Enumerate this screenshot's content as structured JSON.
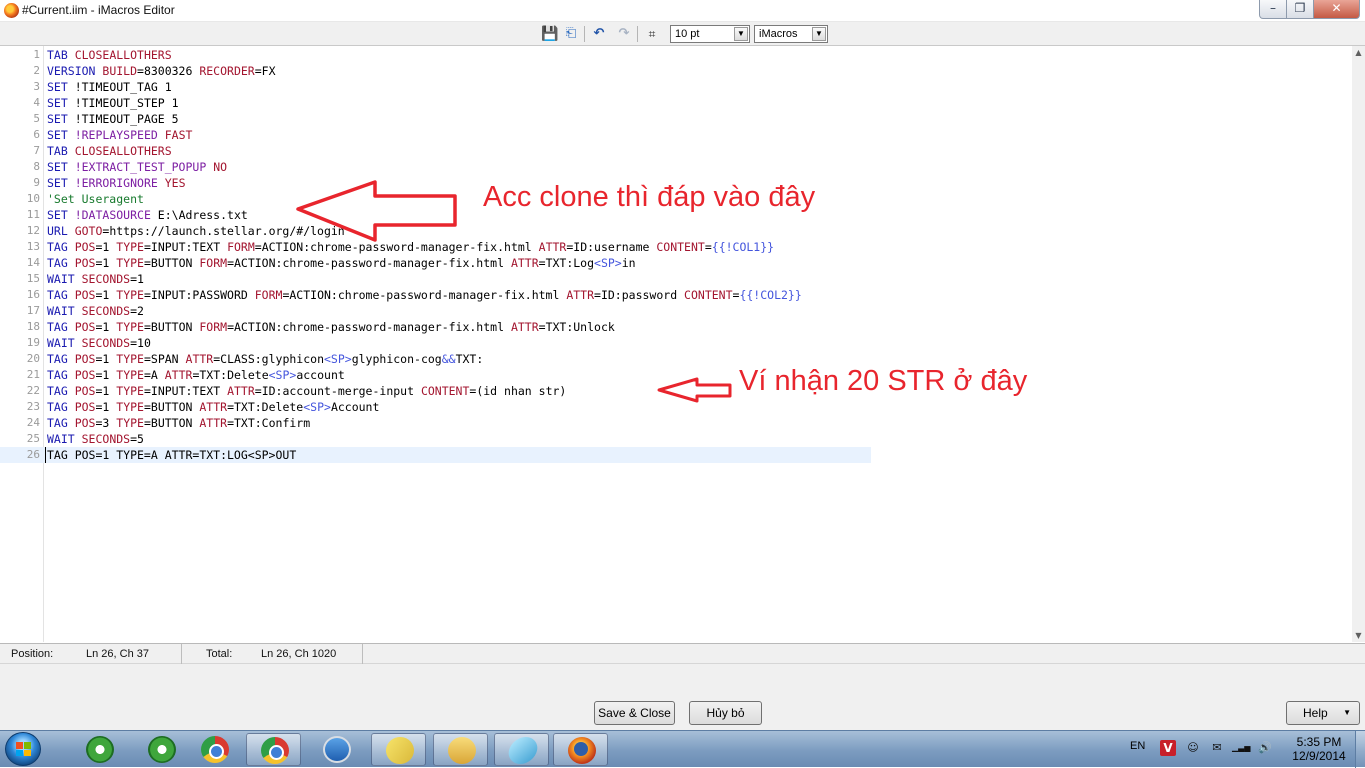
{
  "window": {
    "title": "#Current.iim - iMacros Editor",
    "minimize_glyph": "–",
    "maximize_glyph": "❐",
    "close_glyph": "✕"
  },
  "toolbar": {
    "font_size": "10 pt",
    "syntax_mode": "iMacros",
    "dropdown_glyph": "▼",
    "icons": {
      "save": "💾",
      "open": "⎗",
      "undo": "↶",
      "redo": "↷",
      "find": "⌗"
    }
  },
  "editor": {
    "lines": [
      {
        "n": "1",
        "segs": [
          [
            "cmd",
            "TAB"
          ],
          [
            "",
            ""
          ],
          [
            "prm",
            " CLOSEALLOTHERS"
          ]
        ]
      },
      {
        "n": "2",
        "segs": [
          [
            "cmd",
            "VERSION"
          ],
          [
            "prm",
            " BUILD"
          ],
          [
            "",
            "=8300326"
          ],
          [
            "prm",
            " RECORDER"
          ],
          [
            "",
            "=FX"
          ]
        ]
      },
      {
        "n": "3",
        "segs": [
          [
            "cmd",
            "SET"
          ],
          [
            "",
            " !TIMEOUT_TAG 1"
          ]
        ]
      },
      {
        "n": "4",
        "segs": [
          [
            "cmd",
            "SET"
          ],
          [
            "",
            " !TIMEOUT_STEP 1"
          ]
        ]
      },
      {
        "n": "5",
        "segs": [
          [
            "cmd",
            "SET"
          ],
          [
            "",
            " !TIMEOUT_PAGE 5"
          ]
        ]
      },
      {
        "n": "6",
        "segs": [
          [
            "cmd",
            "SET"
          ],
          [
            "var",
            " !REPLAYSPEED"
          ],
          [
            "prm",
            " FAST"
          ]
        ]
      },
      {
        "n": "7",
        "segs": [
          [
            "cmd",
            "TAB"
          ],
          [
            "prm",
            " CLOSEALLOTHERS"
          ]
        ]
      },
      {
        "n": "8",
        "segs": [
          [
            "cmd",
            "SET"
          ],
          [
            "var",
            " !EXTRACT_TEST_POPUP"
          ],
          [
            "prm",
            " NO"
          ]
        ]
      },
      {
        "n": "9",
        "segs": [
          [
            "cmd",
            "SET"
          ],
          [
            "var",
            " !ERRORIGNORE"
          ],
          [
            "prm",
            " YES"
          ]
        ]
      },
      {
        "n": "10",
        "segs": [
          [
            "cmt",
            "'Set Useragent"
          ]
        ]
      },
      {
        "n": "11",
        "segs": [
          [
            "cmd",
            "SET"
          ],
          [
            "var",
            " !DATASOURCE"
          ],
          [
            "",
            " E:\\Adress.txt"
          ]
        ]
      },
      {
        "n": "12",
        "segs": [
          [
            "cmd",
            "URL"
          ],
          [
            "prm",
            " GOTO"
          ],
          [
            "",
            "=https://launch.stellar.org/#/login"
          ]
        ]
      },
      {
        "n": "13",
        "segs": [
          [
            "cmd",
            "TAG"
          ],
          [
            "prm",
            " POS"
          ],
          [
            "",
            "=1"
          ],
          [
            "prm",
            " TYPE"
          ],
          [
            "",
            "=INPUT:TEXT"
          ],
          [
            "prm",
            " FORM"
          ],
          [
            "",
            "=ACTION:chrome-password-manager-fix.html"
          ],
          [
            "prm",
            " ATTR"
          ],
          [
            "",
            "=ID:username"
          ],
          [
            "prm",
            " CONTENT"
          ],
          [
            "",
            "="
          ],
          [
            "sp",
            "{{!COL1}}"
          ]
        ]
      },
      {
        "n": "14",
        "segs": [
          [
            "cmd",
            "TAG"
          ],
          [
            "prm",
            " POS"
          ],
          [
            "",
            "=1"
          ],
          [
            "prm",
            " TYPE"
          ],
          [
            "",
            "=BUTTON"
          ],
          [
            "prm",
            " FORM"
          ],
          [
            "",
            "=ACTION:chrome-password-manager-fix.html"
          ],
          [
            "prm",
            " ATTR"
          ],
          [
            "",
            "=TXT:Log"
          ],
          [
            "sp",
            "<SP>"
          ],
          [
            "",
            "in"
          ]
        ]
      },
      {
        "n": "15",
        "segs": [
          [
            "cmd",
            "WAIT"
          ],
          [
            "prm",
            " SECONDS"
          ],
          [
            "",
            "=1"
          ]
        ]
      },
      {
        "n": "16",
        "segs": [
          [
            "cmd",
            "TAG"
          ],
          [
            "prm",
            " POS"
          ],
          [
            "",
            "=1"
          ],
          [
            "prm",
            " TYPE"
          ],
          [
            "",
            "=INPUT:PASSWORD"
          ],
          [
            "prm",
            " FORM"
          ],
          [
            "",
            "=ACTION:chrome-password-manager-fix.html"
          ],
          [
            "prm",
            " ATTR"
          ],
          [
            "",
            "=ID:password"
          ],
          [
            "prm",
            " CONTENT"
          ],
          [
            "",
            "="
          ],
          [
            "sp",
            "{{!COL2}}"
          ]
        ]
      },
      {
        "n": "17",
        "segs": [
          [
            "cmd",
            "WAIT"
          ],
          [
            "prm",
            " SECONDS"
          ],
          [
            "",
            "=2"
          ]
        ]
      },
      {
        "n": "18",
        "segs": [
          [
            "cmd",
            "TAG"
          ],
          [
            "prm",
            " POS"
          ],
          [
            "",
            "=1"
          ],
          [
            "prm",
            " TYPE"
          ],
          [
            "",
            "=BUTTON"
          ],
          [
            "prm",
            " FORM"
          ],
          [
            "",
            "=ACTION:chrome-password-manager-fix.html"
          ],
          [
            "prm",
            " ATTR"
          ],
          [
            "",
            "=TXT:Unlock"
          ]
        ]
      },
      {
        "n": "19",
        "segs": [
          [
            "cmd",
            "WAIT"
          ],
          [
            "prm",
            " SECONDS"
          ],
          [
            "",
            "=10"
          ]
        ]
      },
      {
        "n": "20",
        "segs": [
          [
            "cmd",
            "TAG"
          ],
          [
            "prm",
            " POS"
          ],
          [
            "",
            "=1"
          ],
          [
            "prm",
            " TYPE"
          ],
          [
            "",
            "=SPAN"
          ],
          [
            "prm",
            " ATTR"
          ],
          [
            "",
            "=CLASS:glyphicon"
          ],
          [
            "sp",
            "<SP>"
          ],
          [
            "",
            "glyphicon-cog"
          ],
          [
            "sp",
            "&&"
          ],
          [
            "",
            "TXT:"
          ]
        ]
      },
      {
        "n": "21",
        "segs": [
          [
            "cmd",
            "TAG"
          ],
          [
            "prm",
            " POS"
          ],
          [
            "",
            "=1"
          ],
          [
            "prm",
            " TYPE"
          ],
          [
            "",
            "=A"
          ],
          [
            "prm",
            " ATTR"
          ],
          [
            "",
            "=TXT:Delete"
          ],
          [
            "sp",
            "<SP>"
          ],
          [
            "",
            "account"
          ]
        ]
      },
      {
        "n": "22",
        "segs": [
          [
            "cmd",
            "TAG"
          ],
          [
            "prm",
            " POS"
          ],
          [
            "",
            "=1"
          ],
          [
            "prm",
            " TYPE"
          ],
          [
            "",
            "=INPUT:TEXT"
          ],
          [
            "prm",
            " ATTR"
          ],
          [
            "",
            "=ID:account-merge-input"
          ],
          [
            "prm",
            " CONTENT"
          ],
          [
            "",
            "=(id nhan str)"
          ]
        ]
      },
      {
        "n": "23",
        "segs": [
          [
            "cmd",
            "TAG"
          ],
          [
            "prm",
            " POS"
          ],
          [
            "",
            "=1"
          ],
          [
            "prm",
            " TYPE"
          ],
          [
            "",
            "=BUTTON"
          ],
          [
            "prm",
            " ATTR"
          ],
          [
            "",
            "=TXT:Delete"
          ],
          [
            "sp",
            "<SP>"
          ],
          [
            "",
            "Account"
          ]
        ]
      },
      {
        "n": "24",
        "segs": [
          [
            "cmd",
            "TAG"
          ],
          [
            "prm",
            " POS"
          ],
          [
            "",
            "=3"
          ],
          [
            "prm",
            " TYPE"
          ],
          [
            "",
            "=BUTTON"
          ],
          [
            "prm",
            " ATTR"
          ],
          [
            "",
            "=TXT:Confirm"
          ]
        ]
      },
      {
        "n": "25",
        "segs": [
          [
            "cmd",
            "WAIT"
          ],
          [
            "prm",
            " SECONDS"
          ],
          [
            "",
            "=5"
          ]
        ]
      },
      {
        "n": "26",
        "segs": [
          [
            "",
            "TAG POS=1 TYPE=A ATTR=TXT:LOG<SP>OUT"
          ]
        ]
      }
    ]
  },
  "annotations": {
    "top": "Acc clone thì đáp vào đây",
    "bottom": "Ví nhận 20 STR ở đây"
  },
  "status": {
    "position_label": "Position:",
    "position_value": "Ln 26, Ch 37",
    "total_label": "Total:",
    "total_value": "Ln 26, Ch 1020"
  },
  "buttons": {
    "save_close": "Save & Close",
    "cancel": "Hủy bỏ",
    "help": "Help"
  },
  "scrollbar": {
    "up_glyph": "▲",
    "down_glyph": "▼"
  },
  "taskbar": {
    "language": "EN",
    "tray_v": "V",
    "tray_icons": [
      "☺",
      "✉",
      "▁▃▅",
      "🔊"
    ],
    "time": "5:35 PM",
    "date": "12/9/2014"
  },
  "colors": {
    "annotation_red": "#e8252d",
    "keyword_blue": "#1a1ab0",
    "param_red": "#a3152f",
    "variable_purple": "#7d1fa3",
    "comment_green": "#187a2e"
  }
}
